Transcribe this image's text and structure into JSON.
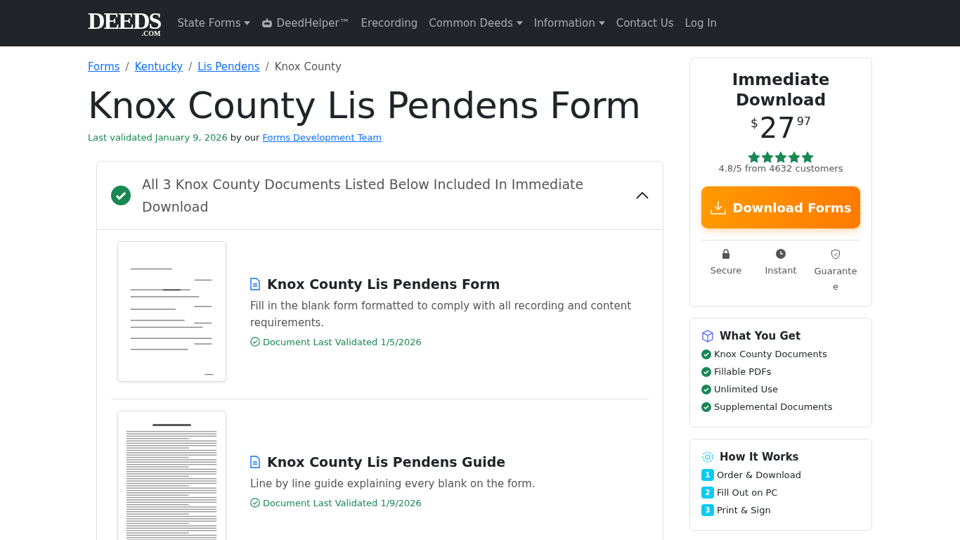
{
  "nav": {
    "logo_main": "DEEDS",
    "logo_sub": ".COM",
    "items": [
      {
        "label": "State Forms",
        "kind": "dropdown"
      },
      {
        "label": "DeedHelper™",
        "kind": "bot"
      },
      {
        "label": "Erecording",
        "kind": "link"
      },
      {
        "label": "Common Deeds",
        "kind": "dropdown"
      },
      {
        "label": "Information",
        "kind": "dropdown"
      },
      {
        "label": "Contact Us",
        "kind": "link"
      },
      {
        "label": "Log In",
        "kind": "link"
      }
    ]
  },
  "breadcrumb": [
    {
      "label": "Forms",
      "link": true
    },
    {
      "separator": "/",
      "label": "Kentucky",
      "link": true
    },
    {
      "separator": "/",
      "label": "Lis Pendens",
      "link": true
    },
    {
      "separator": "/",
      "label": "Knox County",
      "link": false
    }
  ],
  "title": "Knox County Lis Pendens Form",
  "validated": {
    "prefix": "Last validated January 9, 2026",
    "middle": "by our",
    "link": "Forms Development Team"
  },
  "accordion": {
    "title": "All 3 Knox County Documents Listed Below Included In Immediate Download",
    "expanded": true,
    "documents": [
      {
        "title": "Knox County Lis Pendens Form",
        "description": "Fill in the blank form formatted to comply with all recording and content requirements.",
        "validated": "Document Last Validated 1/5/2026",
        "kind": "form"
      },
      {
        "title": "Knox County Lis Pendens Guide",
        "description": "Line by line guide explaining every blank on the form.",
        "validated": "Document Last Validated 1/9/2026",
        "kind": "guide"
      }
    ]
  },
  "purchase": {
    "title": "Immediate Download",
    "currency": "$",
    "dollars": "27",
    "cents": "97",
    "stars": 5,
    "rating": "4.8/5 from 4632 customers",
    "button": "Download Forms",
    "features": [
      {
        "label": "Secure",
        "kind": "lock"
      },
      {
        "label": "Instant",
        "kind": "clock"
      },
      {
        "label": "Guarante\ne",
        "kind": "shield"
      }
    ]
  },
  "what_you_get": {
    "title": "What You Get",
    "items": [
      "Knox County Documents",
      "Fillable PDFs",
      "Unlimited Use",
      "Supplemental Documents"
    ]
  },
  "how_it_works": {
    "title": "How It Works",
    "steps": [
      {
        "number": "1",
        "label": "Order & Download"
      },
      {
        "number": "2",
        "label": "Fill Out on PC"
      },
      {
        "number": "3",
        "label": "Print & Sign"
      }
    ]
  }
}
